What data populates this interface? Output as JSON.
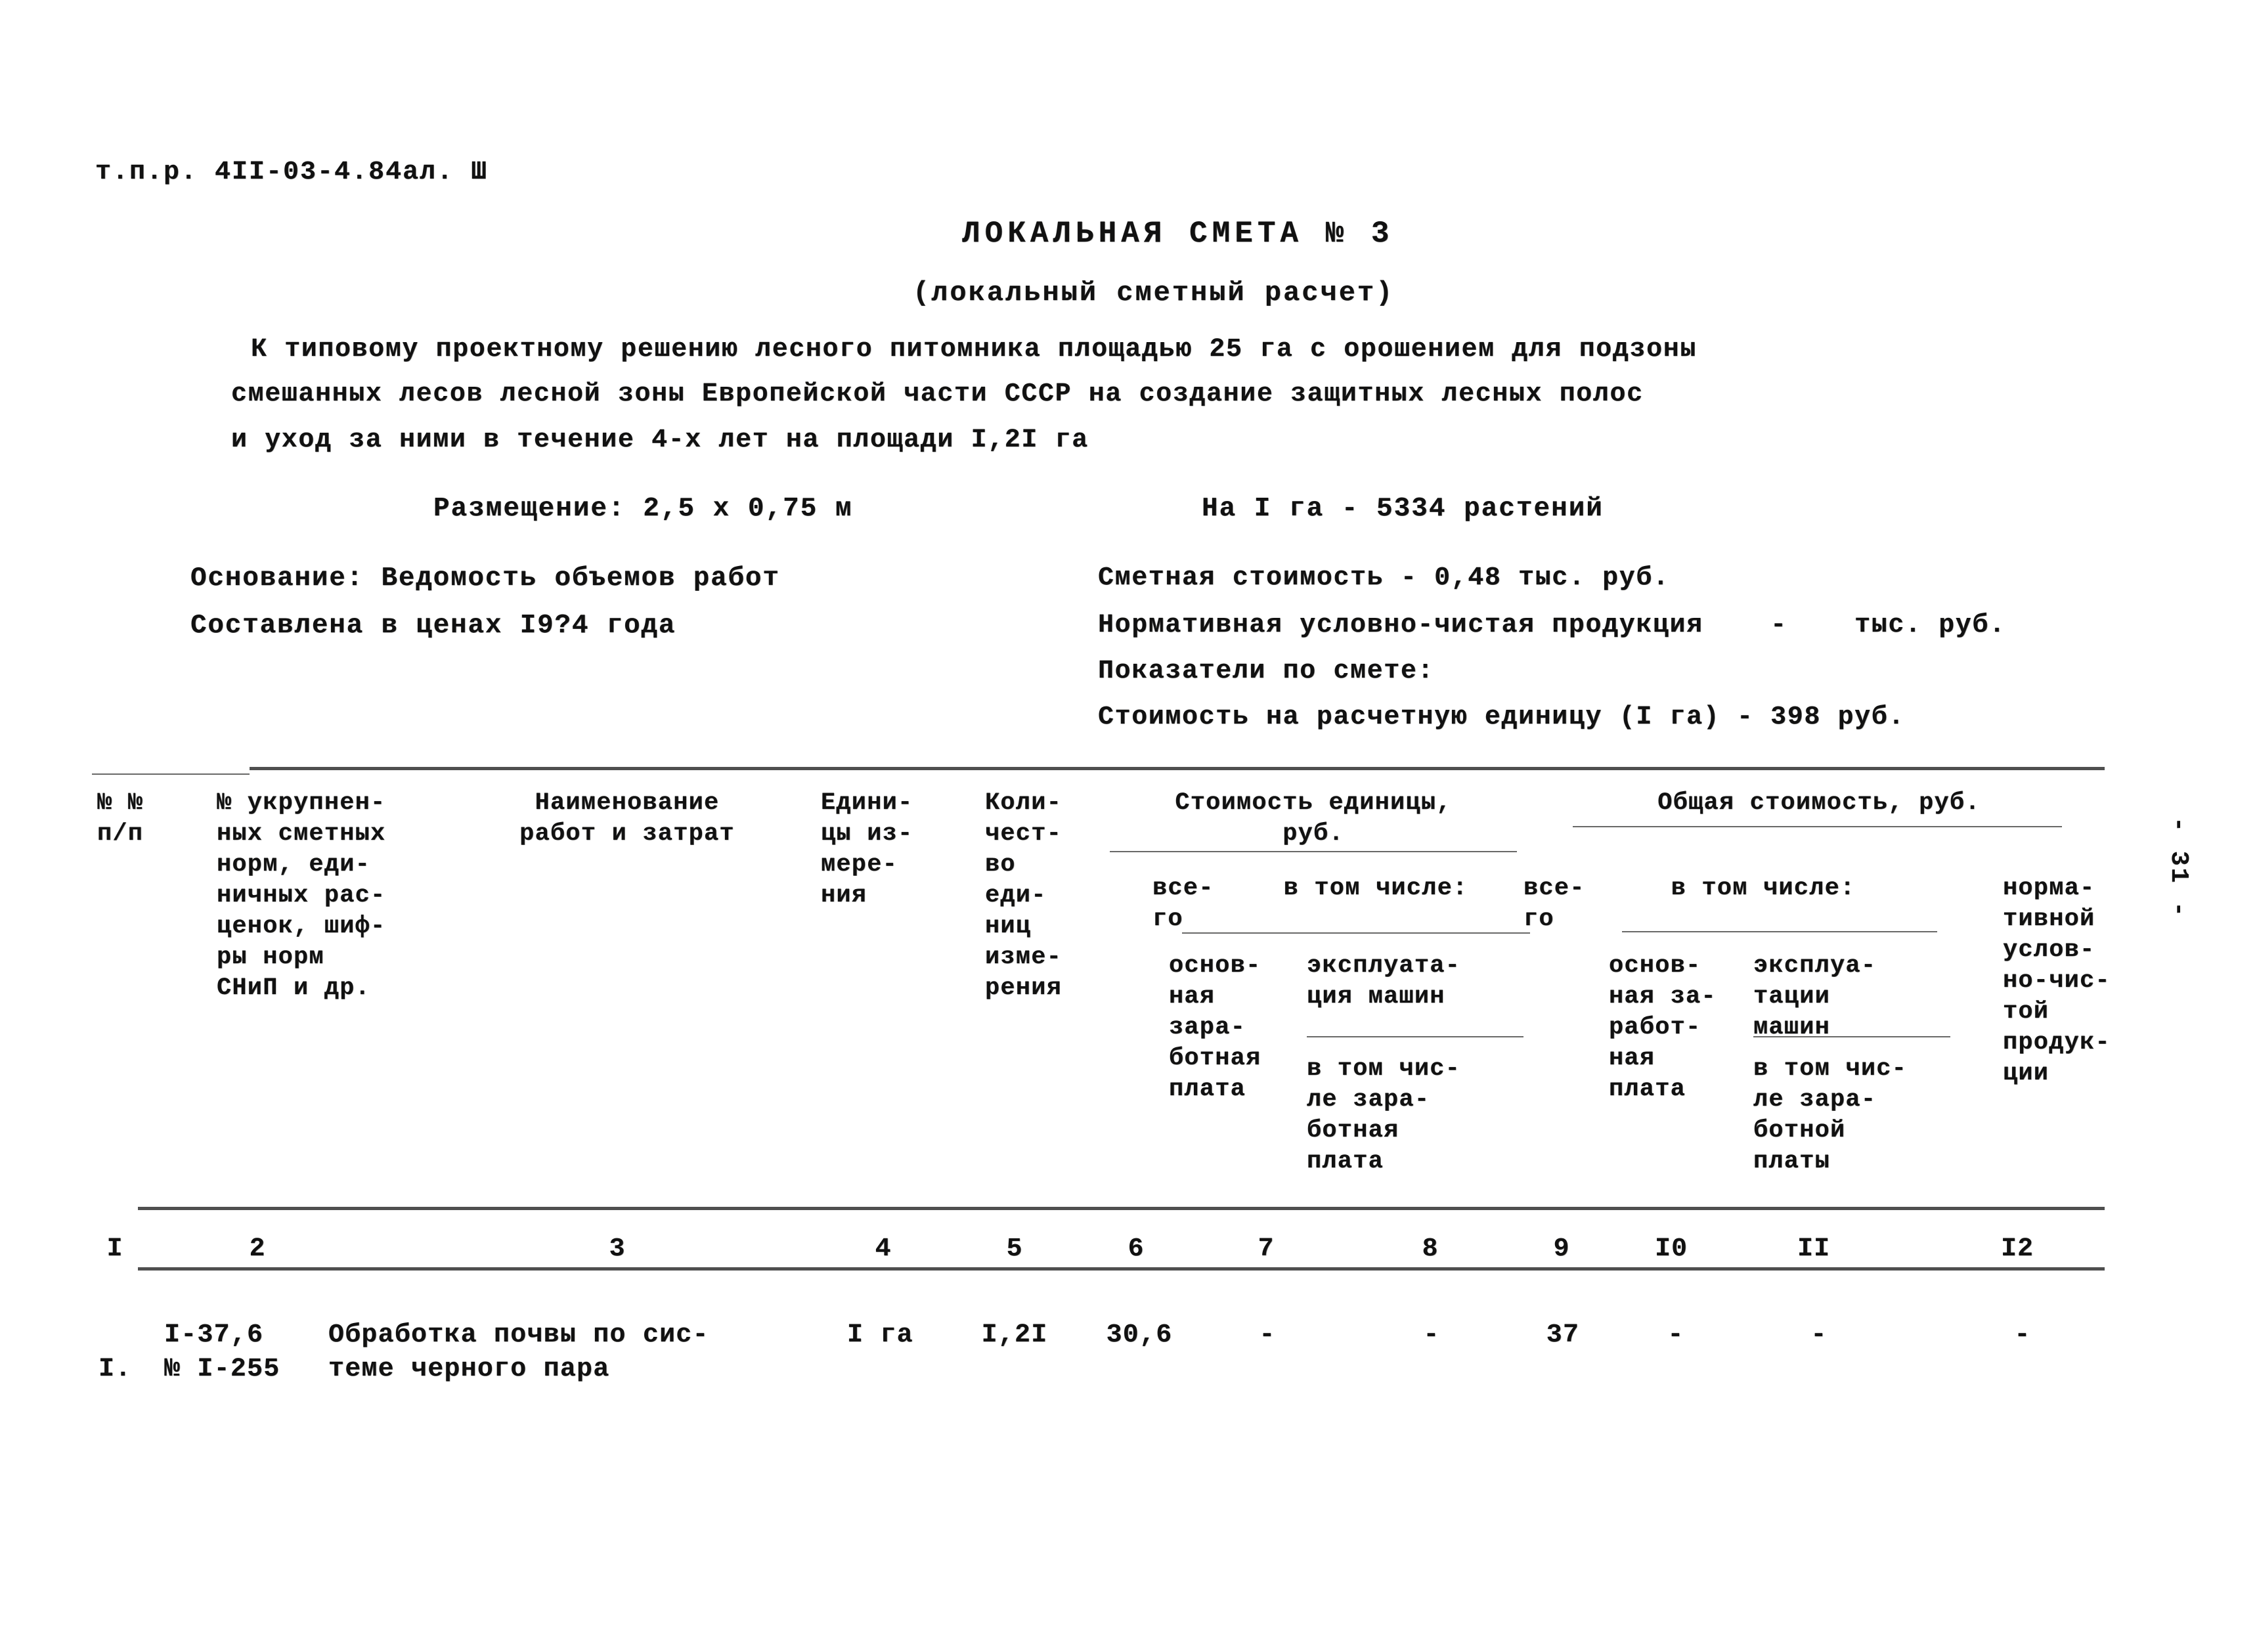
{
  "document": {
    "code": "т.п.р. 4II-03-4.84ал. Ш",
    "title": "ЛОКАЛЬНАЯ СМЕТА № 3",
    "subtitle": "(локальный сметный расчет)",
    "page_number": "- 31 -"
  },
  "description": {
    "line1": "К типовому проектному решению лесного питомника площадью 25 га с орошением для подзоны",
    "line2": "смешанных лесов лесной зоны Европейской части СССР на создание защитных лесных полос",
    "line3": "и уход за ними в течение 4-х лет на площади I,2I га"
  },
  "parameters": {
    "placement_label": "Размещение:",
    "placement_value": "2,5 х 0,75 м",
    "density_label": "На I га -",
    "density_value": "5334 растений"
  },
  "info_left": {
    "basis_label": "Основание:",
    "basis_value": "Ведомость объемов работ",
    "prices_label": "Составлена в ценах",
    "prices_value": "I9?4 года"
  },
  "info_right": {
    "estimate_cost": "Сметная стоимость - 0,48 тыс. руб.",
    "normative_product": "Нормативная условно-чистая продукция    -    тыс. руб.",
    "indicators_label": "Показатели по смете:",
    "unit_cost": "Стоимость на расчетную единицу (I га) - 398 руб."
  },
  "table": {
    "headers": {
      "c1": "№ №\nп/п",
      "c2": "№ укрупнен-\nных сметных\nнорм, еди-\nничных рас-\nценок, шиф-\nры норм\nСНиП и др.",
      "c3": "Наименование\nработ и затрат",
      "c4": "Едини-\nцы из-\nмере-\nния",
      "c5": "Коли-\nчест-\nво\nеди-\nниц\nизме-\nрения",
      "unit_cost_group": "Стоимость единицы,\nруб.",
      "c6": "все-\nго",
      "unit_cost_sub": "в том числе:",
      "c7": "основ-\nная\nзара-\nботная\nплата",
      "c8": "эксплуата-\nция машин",
      "c8b": "в том чис-\nле зара-\nботная\nплата",
      "total_cost_group": "Общая стоимость, руб.",
      "c9": "все-\nго",
      "total_cost_sub": "в том числе:",
      "c10": "основ-\nная за-\nработ-\nная\nплата",
      "c11": "эксплуа-\nтации\nмашин",
      "c11b": "в том чис-\nле зара-\nботной\nплаты",
      "c12": "норма-\nтивной\nуслов-\nно-чис-\nтой\nпродук-\nции"
    },
    "column_numbers": [
      "I",
      "2",
      "3",
      "4",
      "5",
      "6",
      "7",
      "8",
      "9",
      "I0",
      "II",
      "I2"
    ],
    "rows": [
      {
        "num": "I.",
        "code": "I-37,6\n№ I-255",
        "name": "Обработка почвы по сис-\nтеме черного пара",
        "unit": "I га",
        "qty": "I,2I",
        "unit_total": "30,6",
        "unit_wage": "-",
        "unit_machine": "-",
        "total": "37",
        "total_wage": "-",
        "total_machine": "-",
        "normative": "-"
      }
    ]
  }
}
